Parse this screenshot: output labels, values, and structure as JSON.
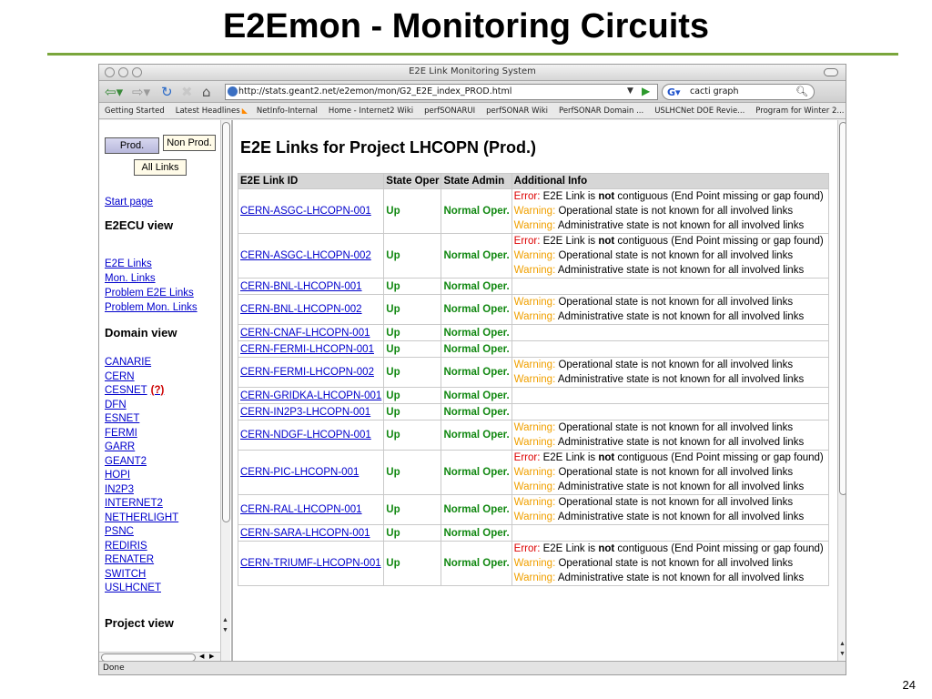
{
  "slide": {
    "title": "E2Emon - Monitoring Circuits",
    "number": "24"
  },
  "browser": {
    "window_title": "E2E Link Monitoring System",
    "url": "http://stats.geant2.net/e2emon/mon/G2_E2E_index_PROD.html",
    "search_value": "cacti graph",
    "bookmarks": [
      "Getting Started",
      "Latest Headlines",
      "NetInfo-Internal",
      "Home - Internet2 Wiki",
      "perfSONARUI",
      "perfSONAR Wiki",
      "PerfSONAR Domain ...",
      "USLHCNet DOE Revie...",
      "Program for Winter 2..."
    ],
    "status": "Done"
  },
  "left": {
    "prod_button": "Prod.",
    "nonprod_button": "Non Prod.",
    "alllinks_button": "All Links",
    "start_page": "Start page",
    "e2ecu_heading": "E2ECU view",
    "e2ecu_links": [
      "E2E Links",
      "Mon. Links",
      "Problem E2E Links",
      "Problem Mon. Links"
    ],
    "domain_heading": "Domain view",
    "domains": [
      "CANARIE",
      "CERN",
      "CESNET",
      "DFN",
      "ESNET",
      "FERMI",
      "GARR",
      "GEANT2",
      "HOPI",
      "IN2P3",
      "INTERNET2",
      "NETHERLIGHT",
      "PSNC",
      "REDIRIS",
      "RENATER",
      "SWITCH",
      "USLHCNET"
    ],
    "cesnet_flag": "(?)",
    "project_heading": "Project view"
  },
  "main": {
    "heading": "E2E Links for Project LHCOPN (Prod.)",
    "columns": [
      "E2E Link ID",
      "State Oper",
      "State Admin",
      "Additional Info"
    ],
    "msg": {
      "error_label": "Error:",
      "warning_label": "Warning:",
      "not_contig_pre": " E2E Link is ",
      "not_word": "not",
      "not_contig_post": " contiguous (End Point missing or gap found)",
      "oper_unknown": " Operational state is not known for all involved links",
      "admin_unknown": " Administrative state is not known for all involved links"
    },
    "rows": [
      {
        "id": "CERN-ASGC-LHCOPN-001",
        "oper": "Up",
        "admin": "Normal Oper.",
        "info": [
          "error",
          "oper",
          "admin"
        ]
      },
      {
        "id": "CERN-ASGC-LHCOPN-002",
        "oper": "Up",
        "admin": "Normal Oper.",
        "info": [
          "error",
          "oper",
          "admin"
        ]
      },
      {
        "id": "CERN-BNL-LHCOPN-001",
        "oper": "Up",
        "admin": "Normal Oper.",
        "info": []
      },
      {
        "id": "CERN-BNL-LHCOPN-002",
        "oper": "Up",
        "admin": "Normal Oper.",
        "info": [
          "oper",
          "admin"
        ]
      },
      {
        "id": "CERN-CNAF-LHCOPN-001",
        "oper": "Up",
        "admin": "Normal Oper.",
        "info": []
      },
      {
        "id": "CERN-FERMI-LHCOPN-001",
        "oper": "Up",
        "admin": "Normal Oper.",
        "info": []
      },
      {
        "id": "CERN-FERMI-LHCOPN-002",
        "oper": "Up",
        "admin": "Normal Oper.",
        "info": [
          "oper",
          "admin"
        ]
      },
      {
        "id": "CERN-GRIDKA-LHCOPN-001",
        "oper": "Up",
        "admin": "Normal Oper.",
        "info": []
      },
      {
        "id": "CERN-IN2P3-LHCOPN-001",
        "oper": "Up",
        "admin": "Normal Oper.",
        "info": []
      },
      {
        "id": "CERN-NDGF-LHCOPN-001",
        "oper": "Up",
        "admin": "Normal Oper.",
        "info": [
          "oper",
          "admin"
        ]
      },
      {
        "id": "CERN-PIC-LHCOPN-001",
        "oper": "Up",
        "admin": "Normal Oper.",
        "info": [
          "error",
          "oper",
          "admin"
        ]
      },
      {
        "id": "CERN-RAL-LHCOPN-001",
        "oper": "Up",
        "admin": "Normal Oper.",
        "info": [
          "oper",
          "admin"
        ]
      },
      {
        "id": "CERN-SARA-LHCOPN-001",
        "oper": "Up",
        "admin": "Normal Oper.",
        "info": []
      },
      {
        "id": "CERN-TRIUMF-LHCOPN-001",
        "oper": "Up",
        "admin": "Normal Oper.",
        "info": [
          "error",
          "oper",
          "admin"
        ]
      }
    ]
  },
  "colors": {
    "accent_rule": "#7aa63c",
    "link": "#0000cc",
    "state_green": "#118811",
    "error_red": "#dd0000",
    "warning_orange": "#f0a000"
  },
  "icons": [
    "back-arrow-icon",
    "forward-arrow-icon",
    "reload-icon",
    "stop-icon",
    "home-icon",
    "globe-icon",
    "go-icon",
    "google-icon",
    "search-icon",
    "rss-icon"
  ]
}
